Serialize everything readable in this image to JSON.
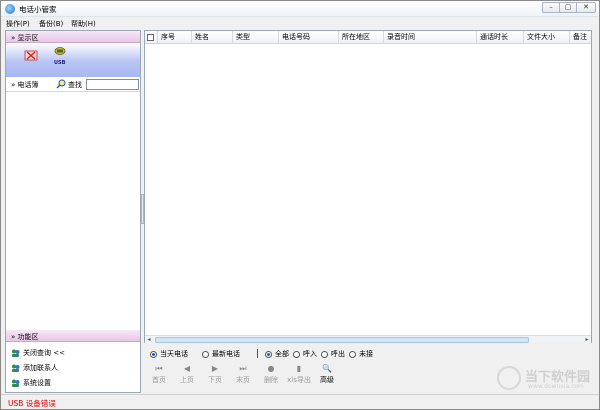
{
  "window": {
    "title": "电话小管家",
    "controls": [
      "–",
      "▢",
      "✕"
    ]
  },
  "menu": [
    "操作(P)",
    "备份(B)",
    "帮助(H)"
  ],
  "left": {
    "display_header": "显示区",
    "phonebook_label": "电话簿",
    "find_label": "查找",
    "search_value": "",
    "search_placeholder": "",
    "usb_label": "USB",
    "function_header": "功能区",
    "functions": [
      "关闭查询 <<",
      "添加联系人",
      "系统设置"
    ]
  },
  "table": {
    "columns": [
      "序号",
      "姓名",
      "类型",
      "电话号码",
      "所在地区",
      "录音时间",
      "通话时长",
      "文件大小",
      "备注"
    ],
    "rows": []
  },
  "filters": {
    "date": [
      {
        "label": "当天电话",
        "checked": true
      },
      {
        "label": "最新电话",
        "checked": false
      }
    ],
    "type": [
      {
        "label": "全部",
        "checked": true
      },
      {
        "label": "呼入",
        "checked": false
      },
      {
        "label": "呼出",
        "checked": false
      },
      {
        "label": "未接",
        "checked": false
      }
    ]
  },
  "nav": [
    {
      "label": "首页",
      "icon": "first-page-icon",
      "glyph": "⏮",
      "enabled": false
    },
    {
      "label": "上页",
      "icon": "prev-page-icon",
      "glyph": "◀",
      "enabled": false
    },
    {
      "label": "下页",
      "icon": "next-page-icon",
      "glyph": "▶",
      "enabled": false
    },
    {
      "label": "末页",
      "icon": "last-page-icon",
      "glyph": "⏭",
      "enabled": false
    },
    {
      "label": "删除",
      "icon": "delete-icon",
      "glyph": "●",
      "enabled": false
    },
    {
      "label": "xls导出",
      "icon": "export-xls-icon",
      "glyph": "▮",
      "enabled": false
    },
    {
      "label": "高级",
      "icon": "advanced-search-icon",
      "glyph": "🔍",
      "enabled": true
    }
  ],
  "status": {
    "text": "USB 设备错误",
    "color": "#e00000"
  },
  "watermark": {
    "title": "当下软件园",
    "url": "www.downxia.com"
  },
  "colors": {
    "section_header": "#e7c7e7",
    "display_gradient": "#a9b7f2",
    "accent": "#1c5fb0"
  }
}
